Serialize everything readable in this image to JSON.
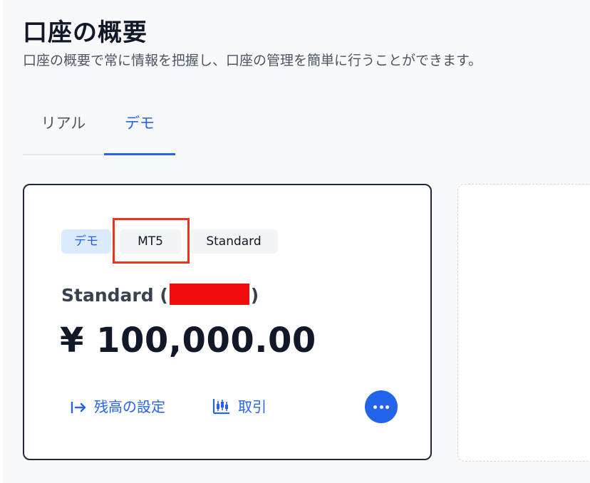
{
  "header": {
    "title": "口座の概要",
    "subtitle": "口座の概要で常に情報を把握し、口座の管理を簡単に行うことができます。"
  },
  "tabs": [
    {
      "label": "リアル",
      "active": false
    },
    {
      "label": "デモ",
      "active": true
    }
  ],
  "account_card": {
    "badges": [
      "デモ",
      "MT5",
      "Standard"
    ],
    "name_prefix": "Standard (",
    "name_suffix": ")",
    "balance": "¥ 100,000.00",
    "actions": {
      "settings_label": "残高の設定",
      "trade_label": "取引"
    },
    "more_icon": "more-icon"
  },
  "colors": {
    "accent": "#2563eb",
    "highlight": "#e8351e",
    "redaction": "#f20d0d"
  }
}
